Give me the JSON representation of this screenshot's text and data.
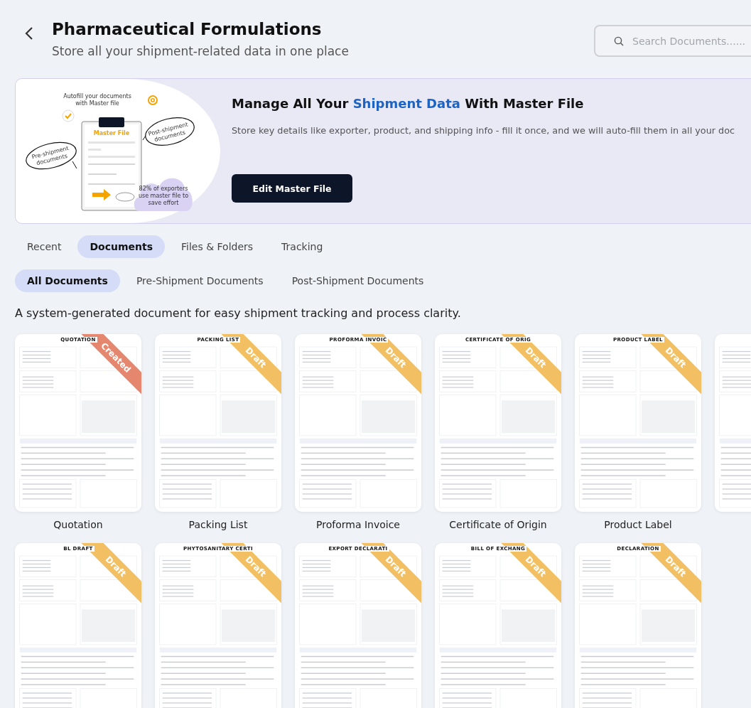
{
  "header": {
    "title": "Pharmaceutical Formulations",
    "subtitle": "Store all your shipment-related data in one place",
    "search": {
      "placeholder": "Search Documents......"
    }
  },
  "banner": {
    "illustration": {
      "caption": "Autofill your documents with Master file",
      "clipboard_title": "Master File",
      "left_bubble": "Pre-shipment documents",
      "right_bubble": "Post-shipment documents",
      "cloud_note": "82% of exporters use master file to save effort"
    },
    "title_parts": [
      {
        "text": "Manage All Your ",
        "highlight": false
      },
      {
        "text": "Shipment Data",
        "highlight": true
      },
      {
        "text": " With Master File",
        "highlight": false
      }
    ],
    "description": "Store key details like exporter, product, and shipping info - fill it once, and we will auto-fill them in all your doc",
    "button": "Edit Master File"
  },
  "tabs": [
    {
      "label": "Recent",
      "selected": false
    },
    {
      "label": "Documents",
      "selected": true
    },
    {
      "label": "Files & Folders",
      "selected": false
    },
    {
      "label": "Tracking",
      "selected": false
    }
  ],
  "sub_tabs": [
    {
      "label": "All Documents",
      "selected": true
    },
    {
      "label": "Pre-Shipment Documents",
      "selected": false
    },
    {
      "label": "Post-Shipment Documents",
      "selected": false
    }
  ],
  "intro": "A system-generated document for easy shipment tracking and process clarity.",
  "documents": [
    {
      "preview_title": "QUOTATION",
      "status": "Created",
      "color": "#e5876f",
      "label": "Quotation"
    },
    {
      "preview_title": "PACKING LIST",
      "status": "Draft",
      "color": "#f2c063",
      "label": "Packing List"
    },
    {
      "preview_title": "PROFORMA INVOIC",
      "status": "Draft",
      "color": "#f2c063",
      "label": "Proforma Invoice"
    },
    {
      "preview_title": "CERTIFICATE OF ORIG",
      "status": "Draft",
      "color": "#f2c063",
      "label": "Certificate of Origin"
    },
    {
      "preview_title": "PRODUCT LABEL",
      "status": "Draft",
      "color": "#f2c063",
      "label": "Product Label"
    },
    {
      "kind": "blank"
    },
    {
      "preview_title": "BL DRAFT",
      "status": "Draft",
      "color": "#f2c063"
    },
    {
      "preview_title": "PHYTOSANITARY CERTI",
      "status": "Draft",
      "color": "#f2c063"
    },
    {
      "preview_title": "EXPORT DECLARATI",
      "status": "Draft",
      "color": "#f2c063"
    },
    {
      "preview_title": "BILL OF EXCHANG",
      "status": "Draft",
      "color": "#f2c063"
    },
    {
      "preview_title": "DECLARATION",
      "status": "Draft",
      "color": "#f2c063"
    }
  ]
}
